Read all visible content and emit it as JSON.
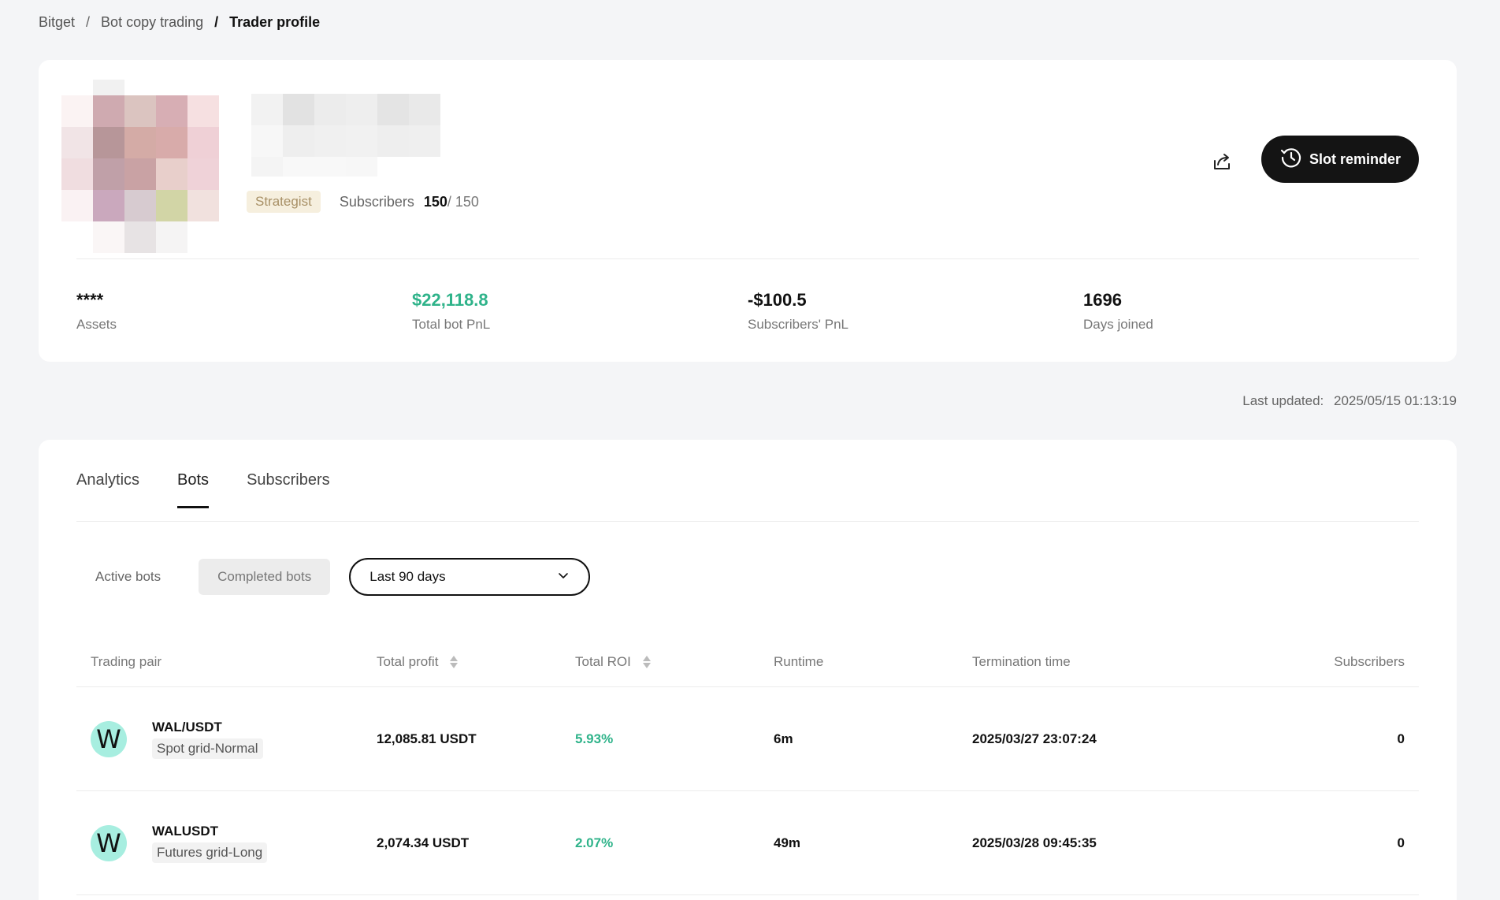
{
  "breadcrumb": {
    "items": [
      "Bitget",
      "Bot copy trading"
    ],
    "separator": "/",
    "current": "Trader profile"
  },
  "profile": {
    "badge": "Strategist",
    "subscribers_label": "Subscribers",
    "subscribers_current": "150",
    "subscribers_max": "/ 150",
    "share_icon": "share-icon",
    "slot_reminder_label": "Slot reminder",
    "slot_icon": "clock-reminder-icon"
  },
  "stats": [
    {
      "value": "****",
      "label": "Assets"
    },
    {
      "value": "$22,118.8",
      "label": "Total bot PnL",
      "color": "#2fb38a"
    },
    {
      "value": "-$100.5",
      "label": "Subscribers' PnL"
    },
    {
      "value": "1696",
      "label": "Days joined"
    }
  ],
  "last_updated": {
    "label": "Last updated:",
    "value": "2025/05/15 01:13:19"
  },
  "tabs": [
    {
      "label": "Analytics",
      "active": false
    },
    {
      "label": "Bots",
      "active": true
    },
    {
      "label": "Subscribers",
      "active": false
    }
  ],
  "filters": {
    "active_bots": "Active bots",
    "completed_bots": "Completed bots",
    "period": "Last 90 days"
  },
  "table": {
    "headers": {
      "pair": "Trading pair",
      "profit": "Total profit",
      "roi": "Total ROI",
      "runtime": "Runtime",
      "termination": "Termination time",
      "subscribers": "Subscribers"
    },
    "rows": [
      {
        "coin_letter": "W",
        "pair": "WAL/USDT",
        "type": "Spot grid-Normal",
        "profit": "12,085.81 USDT",
        "roi": "5.93%",
        "runtime": "6m",
        "termination": "2025/03/27 23:07:24",
        "subscribers": "0"
      },
      {
        "coin_letter": "W",
        "pair": "WALUSDT",
        "type": "Futures grid-Long",
        "profit": "2,074.34 USDT",
        "roi": "2.07%",
        "runtime": "49m",
        "termination": "2025/03/28 09:45:35",
        "subscribers": "0"
      }
    ]
  },
  "colors": {
    "accent_green": "#2fb38a",
    "coin_bg": "#a7eee0",
    "badge_bg": "#f6efde"
  }
}
